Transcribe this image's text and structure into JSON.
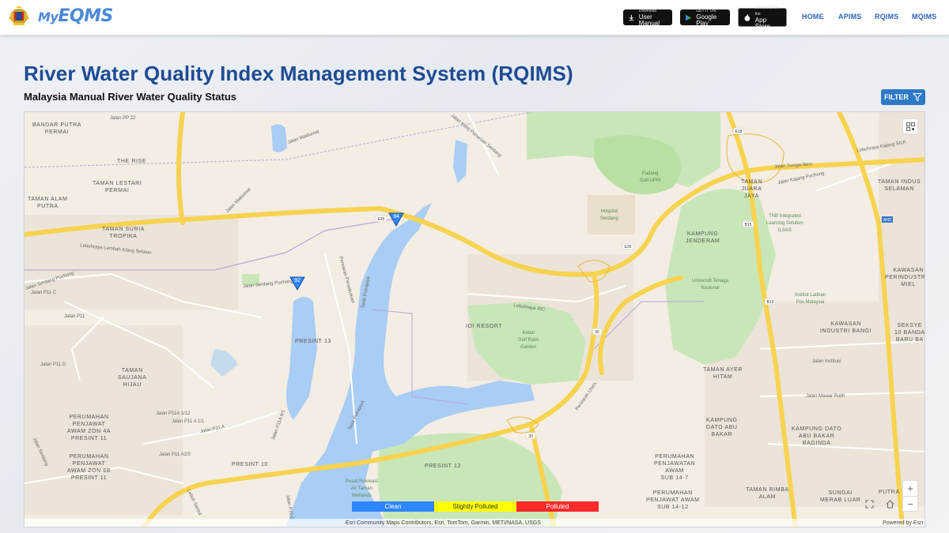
{
  "header": {
    "logo": {
      "prefix": "My",
      "main": "EQMS"
    },
    "store_buttons": {
      "manual": {
        "small": "Download",
        "label": "User Manual"
      },
      "play": {
        "small": "GET IT ON",
        "label": "Google Play"
      },
      "apple": {
        "small": "Download on the",
        "label": "App Store"
      }
    },
    "nav": [
      "HOME",
      "APIMS",
      "RQIMS",
      "MQIMS"
    ]
  },
  "page": {
    "title": "River Water Quality Index Management System (RQIMS)",
    "subtitle": "Malaysia Manual River Water Quality Status",
    "filter_label": "FILTER"
  },
  "map": {
    "place_labels": [
      "BANDAR PUTRA\nPERMAI",
      "THE RISE",
      "TAMAN LESTARI\nPERMAI",
      "TAMAN ALAM\nPUTRA",
      "TAMAN SURIA\nTROPIKA",
      "PRESINT 13",
      "IOI RESORT",
      "TAMAN\nSAUJANA\nHIJAU",
      "PERUMAHAN\nPENJAWAT\nAWAM ZON 4A\nPRESINT 11",
      "PERUMAHAN\nPENJAWAT\nAWAM ZON 6B\nPRESINT 11",
      "PRESINT 10",
      "PRESINT 12",
      "TAMAN\nJUARA\nJAYA",
      "KAMPUNG\nJENDERAM",
      "TAMAN INDUS\nSELAMAN",
      "KAWASAN\nPERINDUSTRIA\nMIEL",
      "KAWASAN\nINDUSTRI BANGI",
      "SEKSYE\n10 BANDA\nBARU BA",
      "TAMAN AYER\nHITAM",
      "KAMPUNG\nDATO ABU\nBAKAR",
      "KAMPUNG DATO\nABU BAKAR\nBAGINDA",
      "PERUMAHAN\nPENJAWATAN\nAWAM\nSUB 14-7",
      "TAMAN RIMBA\nALAM",
      "PERUMAHAN\nPENJAWAT AWAM\nSUB 14-12",
      "SUNGAI\nMERAB LUAR",
      "PUTRA"
    ],
    "road_labels": [
      "Jalan PP 22",
      "Jalan Maklumat",
      "Jalan Kolej Pertanian Serdang",
      "Jalan Makiumat",
      "Lebuhraya Lembah Klang Selatan",
      "Jalan Serdang Puchong",
      "Jalan P11 C",
      "Jalan P11",
      "Jalan P11 D",
      "Persiaran Persekutuan",
      "Tasik Putrajaya",
      "Lebuhraya IRC",
      "Jalan P11A 1/12",
      "Jalan P11 A 1/1",
      "Jalan P11 A",
      "Jalan P11A 6/1",
      "Jalan P11 A2/5",
      "Jalan Serdang Puchong",
      "Lebuh Sentul",
      "Persiaran Utara",
      "Jalan Sungai Besi",
      "Lebuhraya Kajang SILK",
      "Jalan Kajang Puchong",
      "Jalan Institusi",
      "Jalan Mawar Putih",
      "Tasik Putrajaya",
      "Jalan P10 D",
      "Jalan Serdang"
    ],
    "green_labels": [
      "Padang\nGolf UPM",
      "Hospital\nSerdang",
      "TNB Integrated\nLearning Solution\nILSAS",
      "Universiti Tenaga\nNasional",
      "Institut Latihan\nPos Malaysia",
      "Kelab\nGolf Palm\nGarden",
      "Pusat Rekreasi\nAir Taman\nWetlands"
    ],
    "shields": [
      "E26",
      "E26",
      "E18",
      "B15",
      "B13",
      "30",
      "30",
      "AH2"
    ],
    "markers": [
      {
        "value": "94",
        "status": "clean"
      },
      {
        "value": "92",
        "status": "clean"
      }
    ],
    "legend": [
      {
        "label": "Clean",
        "color": "#2f86ff",
        "text_color": "#ffffff"
      },
      {
        "label": "Slightly Polluted",
        "color": "#ffff00",
        "text_color": "#333333"
      },
      {
        "label": "Polluted",
        "color": "#ff2a2a",
        "text_color": "#ffffff"
      }
    ],
    "attribution": "Esri Community Maps Contributors, Esri, TomTom, Garmin, METI/NASA, USGS",
    "powered_by": "Powered by Esri",
    "zoom_in": "+",
    "zoom_out": "−"
  }
}
